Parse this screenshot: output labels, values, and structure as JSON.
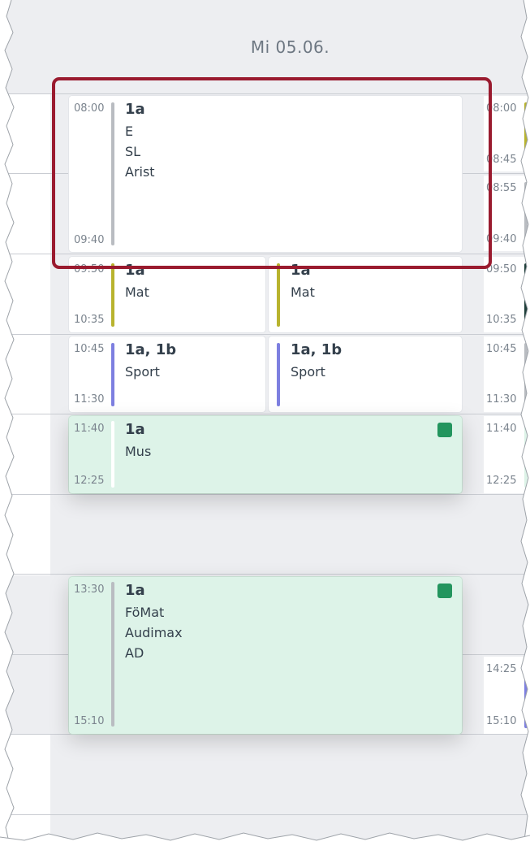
{
  "header": {
    "day_title": "Mi 05.06."
  },
  "lessons": [
    {
      "start": "08:00",
      "end": "09:40",
      "class": "1a",
      "lines": [
        "E",
        "SL",
        "Arist"
      ],
      "bar_color": "#b9bcc1"
    },
    {
      "start": "09:50",
      "end": "10:35",
      "class": "1a",
      "lines": [
        "Mat"
      ],
      "bar_color": "#b8b32e"
    },
    {
      "start": "",
      "end": "",
      "class": "1a",
      "lines": [
        "Mat"
      ],
      "bar_color": "#b8b32e"
    },
    {
      "start": "10:45",
      "end": "11:30",
      "class": "1a, 1b",
      "lines": [
        "Sport"
      ],
      "bar_color": "#7d7fe0"
    },
    {
      "start": "",
      "end": "",
      "class": "1a, 1b",
      "lines": [
        "Sport"
      ],
      "bar_color": "#7d7fe0"
    },
    {
      "start": "11:40",
      "end": "12:25",
      "class": "1a",
      "lines": [
        "Mus"
      ],
      "bar_color": "#ffffff",
      "status_color": "#23955e"
    },
    {
      "start": "13:30",
      "end": "15:10",
      "class": "1a",
      "lines": [
        "FöMat",
        "Audimax",
        "AD"
      ],
      "bar_color": "#b9bcc1",
      "status_color": "#23955e"
    }
  ],
  "right_column": {
    "times": [
      "08:00",
      "08:45",
      "08:55",
      "09:40",
      "09:50",
      "10:35",
      "10:45",
      "11:30",
      "11:40",
      "12:25",
      "14:25",
      "15:10"
    ]
  }
}
